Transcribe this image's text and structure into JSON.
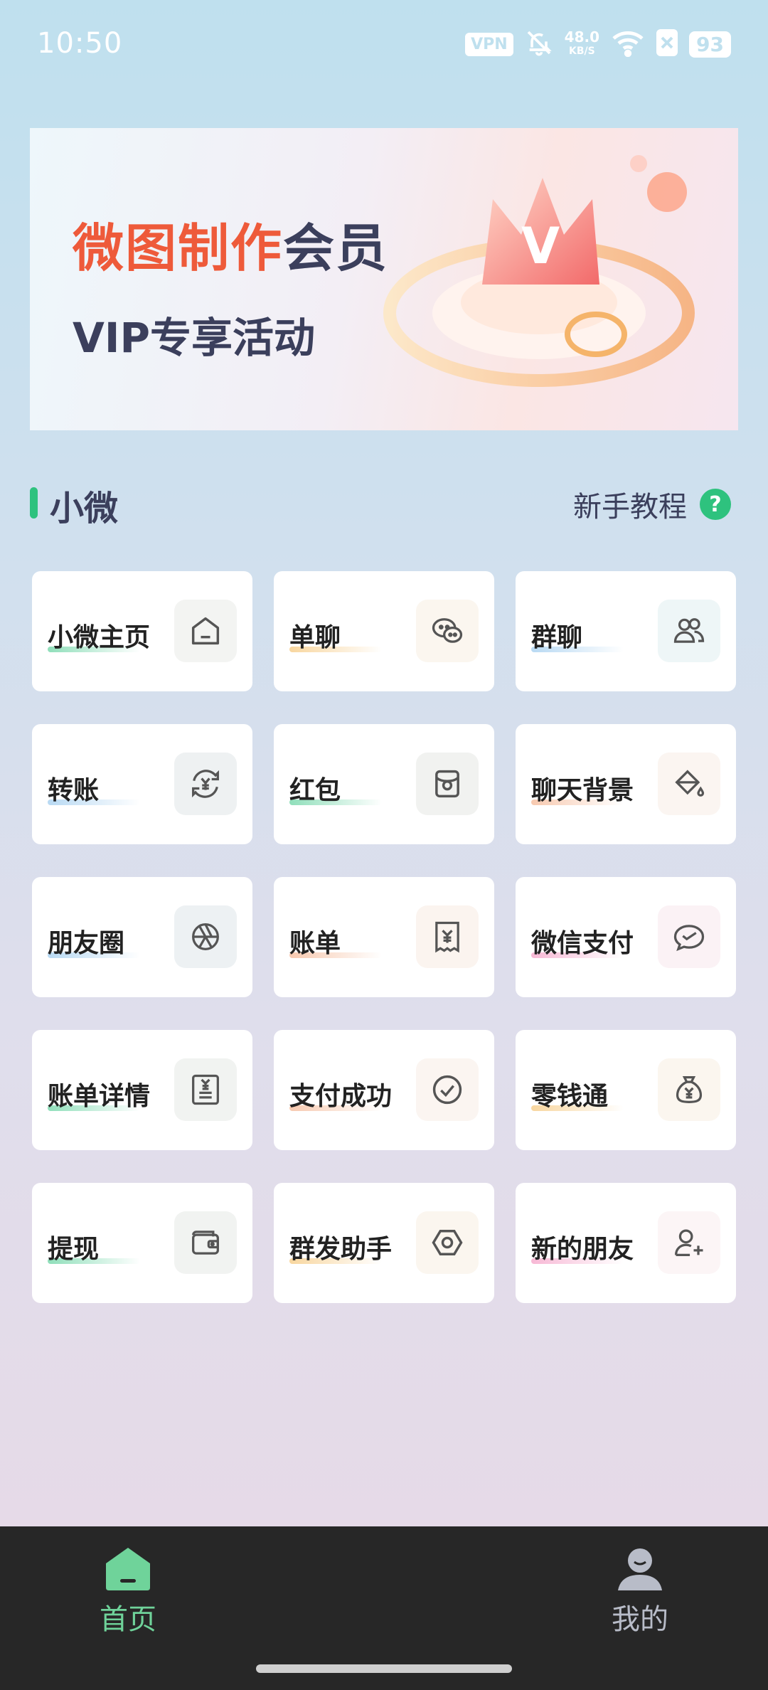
{
  "status_bar": {
    "time": "10:50",
    "vpn": "VPN",
    "net_speed": "48.0",
    "net_unit": "KB/S",
    "battery": "93"
  },
  "banner": {
    "title_orange": "微图制作",
    "title_navy": "会员",
    "subtitle": "VIP专享活动"
  },
  "section": {
    "title": "小微",
    "tutorial_label": "新手教程",
    "help_glyph": "?"
  },
  "grid": {
    "items": [
      {
        "label": "小微主页",
        "icon": "home-icon",
        "accent": "#2ec27e"
      },
      {
        "label": "单聊",
        "icon": "wechat-chat-icon",
        "accent": "#f2b24a"
      },
      {
        "label": "群聊",
        "icon": "group-icon",
        "accent": "#7ab8e8"
      },
      {
        "label": "转账",
        "icon": "transfer-yuan-icon",
        "accent": "#7ab8e8"
      },
      {
        "label": "红包",
        "icon": "red-packet-icon",
        "accent": "#2ec27e"
      },
      {
        "label": "聊天背景",
        "icon": "paint-bucket-icon",
        "accent": "#f09a6a"
      },
      {
        "label": "朋友圈",
        "icon": "moments-icon",
        "accent": "#7ab8e8"
      },
      {
        "label": "账单",
        "icon": "bill-yuan-icon",
        "accent": "#f09a6a"
      },
      {
        "label": "微信支付",
        "icon": "wechat-pay-icon",
        "accent": "#f07ab0"
      },
      {
        "label": "账单详情",
        "icon": "bill-detail-icon",
        "accent": "#2ec27e"
      },
      {
        "label": "支付成功",
        "icon": "check-circle-icon",
        "accent": "#f09a6a"
      },
      {
        "label": "零钱通",
        "icon": "money-bag-icon",
        "accent": "#f2b24a"
      },
      {
        "label": "提现",
        "icon": "wallet-icon",
        "accent": "#2ec27e"
      },
      {
        "label": "群发助手",
        "icon": "hexagon-icon",
        "accent": "#f2b24a"
      },
      {
        "label": "新的朋友",
        "icon": "add-friend-icon",
        "accent": "#f07ab0"
      }
    ]
  },
  "nav": {
    "home_label": "首页",
    "mine_label": "我的",
    "active_color": "#6fd39a",
    "inactive_color": "#b8bcc8"
  }
}
